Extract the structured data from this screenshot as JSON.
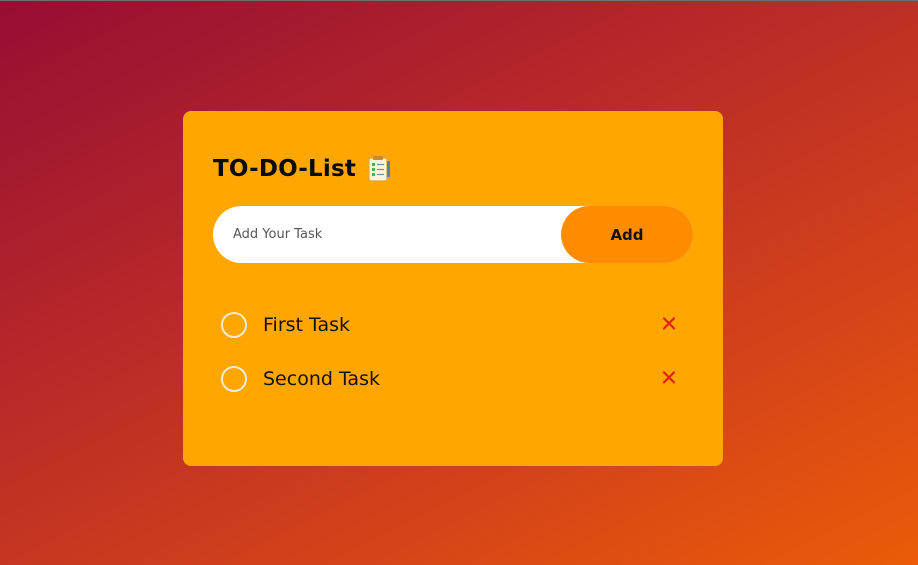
{
  "app": {
    "title": "TO-DO-List",
    "title_icon": "notepad-icon"
  },
  "input": {
    "placeholder": "Add Your Task",
    "value": ""
  },
  "add_button": {
    "label": "Add"
  },
  "tasks": [
    {
      "label": "First Task",
      "completed": false,
      "delete_icon": "close-icon"
    },
    {
      "label": "Second Task",
      "completed": false,
      "delete_icon": "close-icon"
    }
  ],
  "colors": {
    "card": "#ffa700",
    "button": "#ff8c00",
    "delete": "#e0201b",
    "background_start": "#970d33",
    "background_end": "#ec5b08"
  }
}
